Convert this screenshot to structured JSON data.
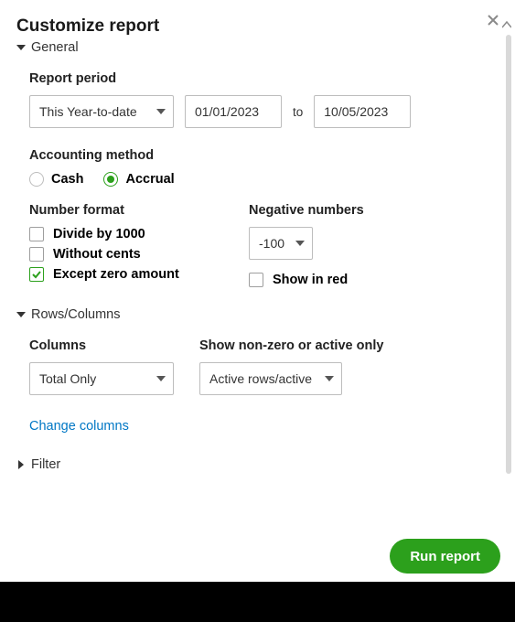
{
  "title": "Customize report",
  "sections": {
    "general": {
      "label": "General",
      "expanded": true
    },
    "rows_columns": {
      "label": "Rows/Columns",
      "expanded": true
    },
    "filter": {
      "label": "Filter",
      "expanded": false
    }
  },
  "report_period": {
    "label": "Report period",
    "preset": "This Year-to-date",
    "from": "01/01/2023",
    "to_label": "to",
    "to": "10/05/2023"
  },
  "accounting_method": {
    "label": "Accounting method",
    "options": {
      "cash": "Cash",
      "accrual": "Accrual"
    },
    "selected": "accrual"
  },
  "number_format": {
    "label": "Number format",
    "divide_by_1000": {
      "label": "Divide by 1000",
      "checked": false
    },
    "without_cents": {
      "label": "Without cents",
      "checked": false
    },
    "except_zero": {
      "label": "Except zero amount",
      "checked": true
    }
  },
  "negative_numbers": {
    "label": "Negative numbers",
    "format": "-100",
    "show_in_red": {
      "label": "Show in red",
      "checked": false
    }
  },
  "columns": {
    "label": "Columns",
    "value": "Total Only",
    "change_link": "Change columns"
  },
  "show_nonzero": {
    "label": "Show non-zero or active only",
    "value": "Active rows/active co"
  },
  "run_button": "Run report"
}
